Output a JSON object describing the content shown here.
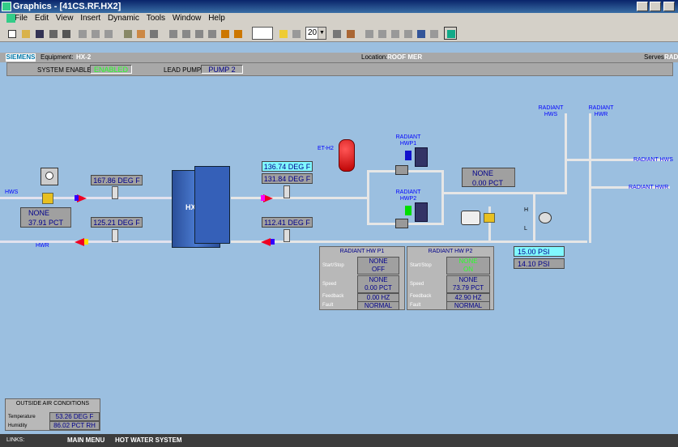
{
  "window": {
    "title": "Graphics - [41CS.RF.HX2]"
  },
  "menu": [
    "File",
    "Edit",
    "View",
    "Insert",
    "Dynamic",
    "Tools",
    "Window",
    "Help"
  ],
  "toolbar": {
    "zoom": "20"
  },
  "header": {
    "logo": "SIEMENS",
    "equipment_label": "Equipment:",
    "equipment": "HX-2",
    "location_label": "Location:",
    "location": "ROOF MER",
    "serves_label": "Serves:",
    "serves": "RAD"
  },
  "subheader": {
    "system_enable_label": "SYSTEM ENABLE",
    "system_enable": "ENABLED",
    "lead_pump_label": "LEAD PUMP",
    "lead_pump": "PUMP 2"
  },
  "diagram": {
    "hws": "HWS",
    "hwr": "HWR",
    "hx": "HX2",
    "valve_value1": "NONE",
    "valve_value2": "37.91 PCT",
    "t1": "167.86 DEG F",
    "t2": "125.21 DEG F",
    "t3": "136.74 DEG F",
    "t4": "131.84 DEG F",
    "t5": "112.41 DEG F",
    "et": "ET-H2",
    "pump1": "RADIANT\nHWP1",
    "pump2": "RADIANT\nHWP2",
    "radiant_hws_top": "RADIANT\nHWS",
    "radiant_hwr_top": "RADIANT\nHWR",
    "radiant_hws": "RADIANT HWS",
    "radiant_hwr": "RADIANT HWR",
    "flow1": "NONE",
    "flow2": "0.00 PCT",
    "psi1": "15.00 PSI",
    "psi2": "14.10 PSI",
    "h": "H",
    "l": "L"
  },
  "p1": {
    "title": "RADIANT HW P1",
    "ss_label": "Start/Stop",
    "ss1": "NONE",
    "ss2": "OFF",
    "speed_label": "Speed",
    "sp1": "NONE",
    "sp2": "0.00 PCT",
    "fb_label": "Feedback",
    "fb": "0.00 HZ",
    "fault_label": "Fault",
    "fault": "NORMAL"
  },
  "p2": {
    "title": "RADIANT HW P2",
    "ss_label": "Start/Stop",
    "ss1": "NONE",
    "ss2": "ON",
    "speed_label": "Speed",
    "sp1": "NONE",
    "sp2": "73.79 PCT",
    "fb_label": "Feedback",
    "fb": "42.90 HZ",
    "fault_label": "Fault",
    "fault": "NORMAL"
  },
  "oac": {
    "title": "OUTSIDE AIR CONDITIONS",
    "temp_label": "Temperature",
    "temp": "53.26 DEG F",
    "hum_label": "Humidity",
    "hum": "86.02 PCT RH"
  },
  "links": {
    "label": "LINKS:",
    "main": "MAIN MENU",
    "hot": "HOT WATER SYSTEM"
  },
  "colors": {
    "enabled_green": "#2aff2a",
    "value_blue": "#00008b",
    "cyan": "#80f8ff"
  }
}
